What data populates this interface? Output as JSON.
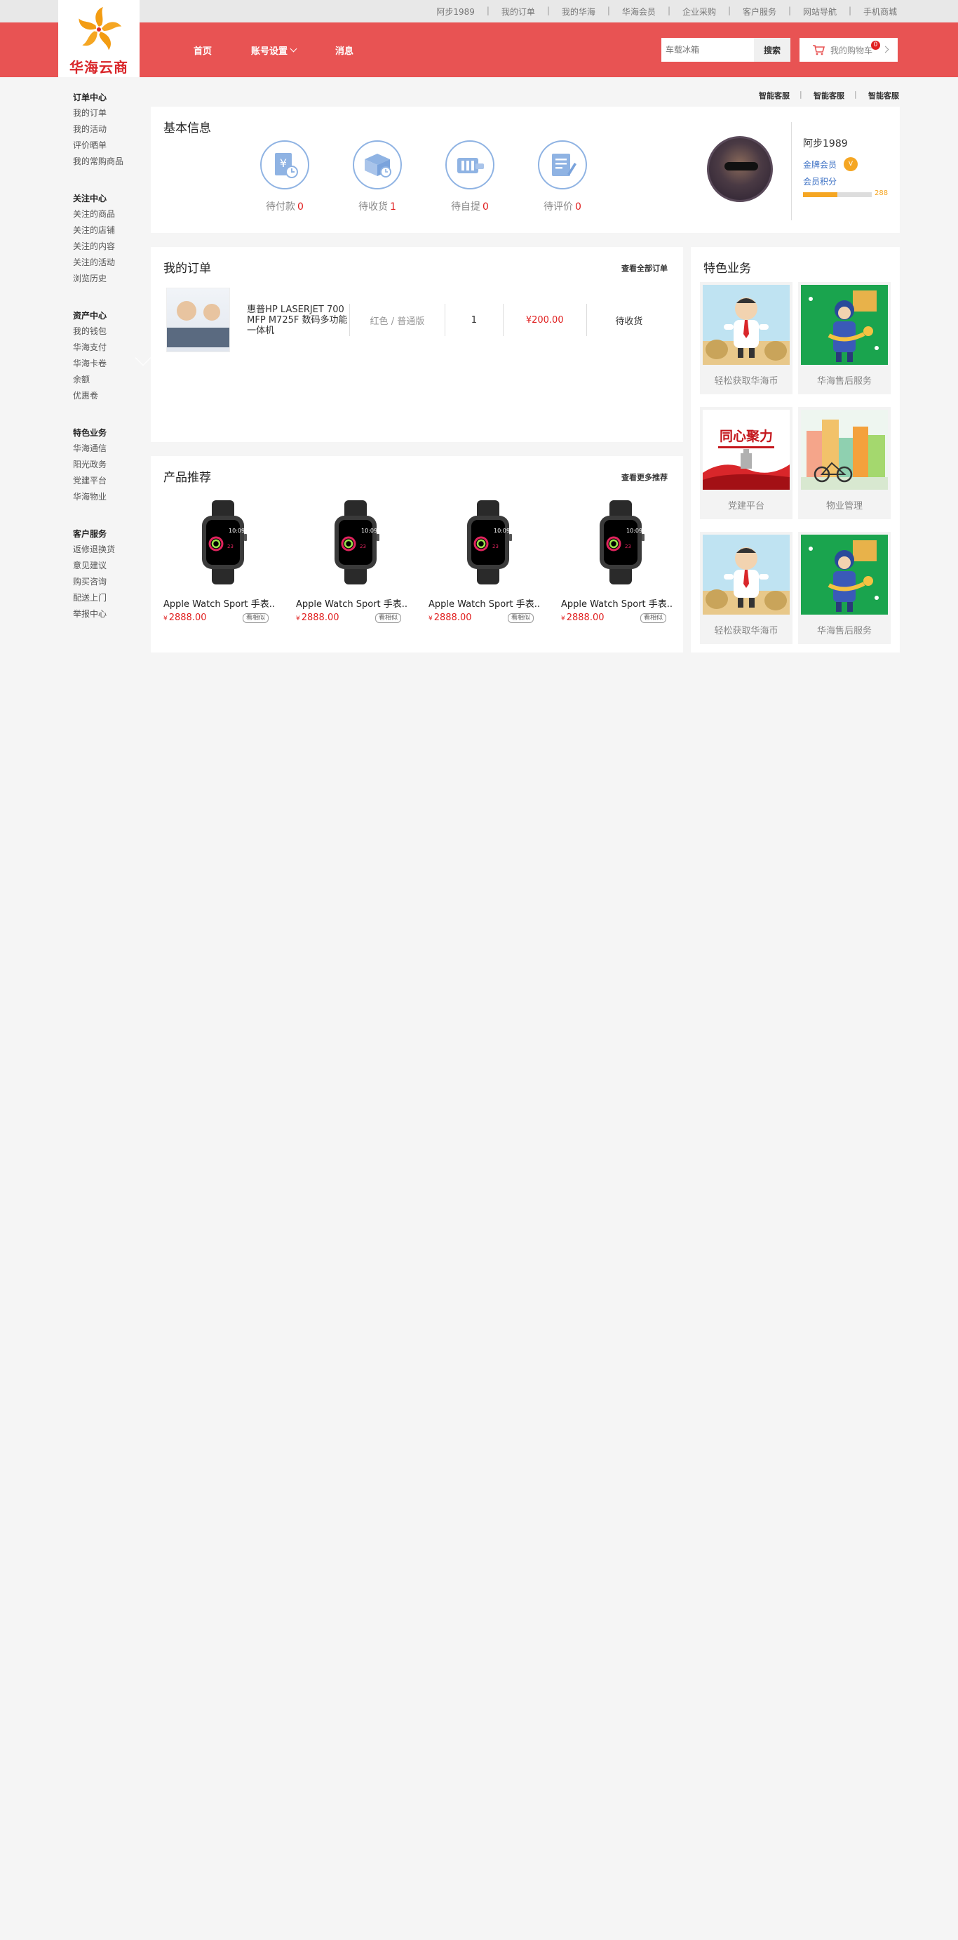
{
  "topbar": {
    "links": [
      "阿步1989",
      "我的订单",
      "我的华海",
      "华海会员",
      "企业采购",
      "客户服务",
      "网站导航",
      "手机商城"
    ]
  },
  "brand": {
    "name": "华海云商",
    "color": "#e85353",
    "accent": "#d9262a"
  },
  "nav": {
    "home": "首页",
    "account": "账号设置",
    "messages": "消息"
  },
  "search": {
    "placeholder": "车载冰箱",
    "button": "搜索"
  },
  "cart": {
    "label": "我的购物车",
    "count": "0",
    "icon": "cart-icon"
  },
  "sidebar": {
    "groups": [
      {
        "title": "订单中心",
        "items": [
          "我的订单",
          "我的活动",
          "评价晒单",
          "我的常购商品"
        ]
      },
      {
        "title": "关注中心",
        "items": [
          "关注的商品",
          "关注的店铺",
          "关注的内容",
          "关注的活动",
          "浏览历史"
        ]
      },
      {
        "title": "资产中心",
        "items": [
          "我的钱包",
          "华海支付",
          "华海卡卷",
          "余额",
          "优惠卷"
        ]
      },
      {
        "title": "特色业务",
        "items": [
          "华海通信",
          "阳光政务",
          "党建平台",
          "华海物业"
        ]
      },
      {
        "title": "客户服务",
        "items": [
          "返修退换货",
          "意见建议",
          "购买咨询",
          "配送上门",
          "举报中心"
        ]
      }
    ]
  },
  "service_links": [
    "智能客服",
    "智能客服",
    "智能客服"
  ],
  "basic_info": {
    "title": "基本信息",
    "status": [
      {
        "label": "待付款",
        "count": "0",
        "icon": "wallet-icon"
      },
      {
        "label": "待收货",
        "count": "1",
        "icon": "truck-icon"
      },
      {
        "label": "待自提",
        "count": "0",
        "icon": "package-icon"
      },
      {
        "label": "待评价",
        "count": "0",
        "icon": "review-icon"
      }
    ],
    "user": {
      "name": "阿步1989",
      "level": "金牌会员",
      "level_badge": "V",
      "points_label": "会员积分",
      "points": "288",
      "points_fraction": 0.5
    }
  },
  "orders": {
    "title": "我的订单",
    "more": "查看全部订单",
    "items": [
      {
        "name": "惠普HP LASERJET 700 MFP M725F 数码多功能一体机",
        "spec_color": "红色",
        "spec_sep": "/",
        "spec_version": "普通版",
        "qty": "1",
        "price": "¥200.00",
        "status": "待收货"
      }
    ]
  },
  "recommendations": {
    "title": "产品推荐",
    "more": "查看更多推荐",
    "items": [
      {
        "name": "Apple Watch Sport 手表...",
        "price": "2888.00",
        "yen": "¥",
        "button": "看相似"
      },
      {
        "name": "Apple Watch Sport 手表...",
        "price": "2888.00",
        "yen": "¥",
        "button": "看相似"
      },
      {
        "name": "Apple Watch Sport 手表...",
        "price": "2888.00",
        "yen": "¥",
        "button": "看相似"
      },
      {
        "name": "Apple Watch Sport 手表...",
        "price": "2888.00",
        "yen": "¥",
        "button": "看相似"
      }
    ]
  },
  "special": {
    "title": "特色业务",
    "items": [
      {
        "label": "轻松获取华海币",
        "image": "cartoon-businessman"
      },
      {
        "label": "华海售后服务",
        "image": "cartoon-courier"
      },
      {
        "label": "党建平台",
        "image": "party-banner",
        "banner_text": "同心聚力"
      },
      {
        "label": "物业管理",
        "image": "city-bicycle"
      },
      {
        "label": "轻松获取华海币",
        "image": "cartoon-businessman"
      },
      {
        "label": "华海售后服务",
        "image": "cartoon-courier"
      }
    ]
  }
}
